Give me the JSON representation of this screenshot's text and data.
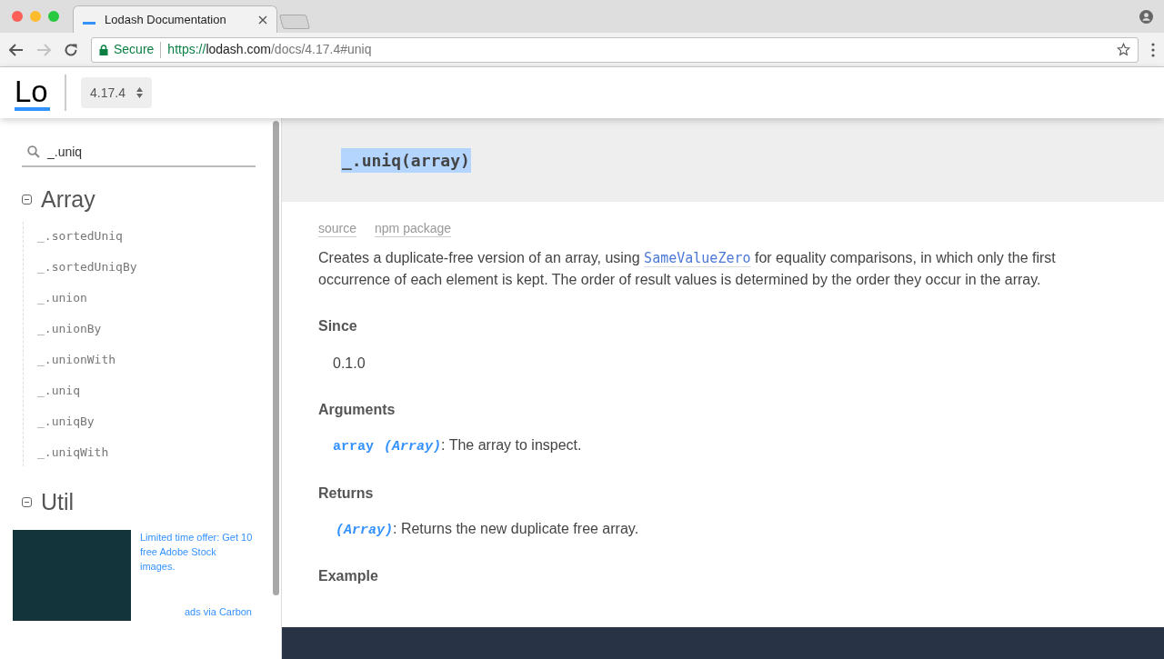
{
  "browser": {
    "tab": {
      "title": "Lodash Documentation",
      "selected": true
    },
    "url": {
      "secure_label": "Secure",
      "scheme": "https://",
      "host": "lodash.com",
      "path": "/docs/4.17.4#uniq"
    }
  },
  "header": {
    "logo": "Lo",
    "version": "4.17.4"
  },
  "sidebar": {
    "search": {
      "value": "_.uniq"
    },
    "groups": [
      {
        "title": "Array",
        "expanded": true,
        "items": [
          {
            "label": "_.sortedUniq"
          },
          {
            "label": "_.sortedUniqBy"
          },
          {
            "label": "_.union"
          },
          {
            "label": "_.unionBy"
          },
          {
            "label": "_.unionWith"
          },
          {
            "label": "_.uniq"
          },
          {
            "label": "_.uniqBy"
          },
          {
            "label": "_.uniqWith"
          }
        ]
      },
      {
        "title": "Util",
        "expanded": true
      }
    ],
    "ad": {
      "text": "Limited time offer: Get 10 free Adobe Stock images.",
      "via": "ads via Carbon"
    }
  },
  "main": {
    "signature": "_.uniq(array)",
    "links": [
      "source",
      "npm package"
    ],
    "description": {
      "before": "Creates a duplicate-free version of an array, using ",
      "link": "SameValueZero",
      "after": " for equality comparisons, in which only the first occurrence of each element is kept. The order of result values is determined by the order they occur in the array."
    },
    "sections": [
      {
        "kind": "version",
        "title": "Since",
        "value": "0.1.0"
      },
      {
        "kind": "param",
        "title": "Arguments",
        "name": "array",
        "type": "(Array)",
        "text": ": The array to inspect."
      },
      {
        "kind": "param",
        "title": "Returns",
        "type": "(Array)",
        "text": ": Returns the new duplicate free array."
      },
      {
        "kind": "heading",
        "title": "Example"
      }
    ]
  }
}
